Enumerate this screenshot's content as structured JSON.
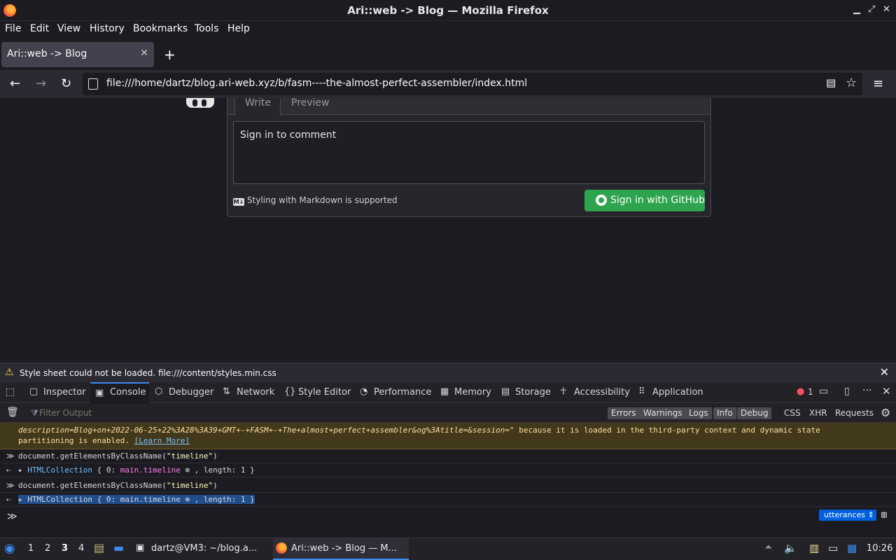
{
  "window": {
    "title": "Ari::web -> Blog — Mozilla Firefox"
  },
  "menu": [
    "File",
    "Edit",
    "View",
    "History",
    "Bookmarks",
    "Tools",
    "Help"
  ],
  "tabs": [
    {
      "label": "Ari::web -> Blog"
    }
  ],
  "address": {
    "url": "file:///home/dartz/blog.ari-web.xyz/b/fasm----the-almost-perfect-assembler/index.html"
  },
  "comment": {
    "tab_write": "Write",
    "tab_preview": "Preview",
    "textarea_placeholder": "Sign in to comment",
    "markdown_note": "Styling with Markdown is supported",
    "signin_button": "Sign in with GitHub"
  },
  "warning_bar": {
    "text": "Style sheet could not be loaded. file:///content/styles.min.css"
  },
  "devtools": {
    "tabs": [
      {
        "label": "Inspector",
        "icon": "inspector-icon"
      },
      {
        "label": "Console",
        "icon": "console-icon"
      },
      {
        "label": "Debugger",
        "icon": "debugger-icon"
      },
      {
        "label": "Network",
        "icon": "network-icon"
      },
      {
        "label": "Style Editor",
        "icon": "style-editor-icon"
      },
      {
        "label": "Performance",
        "icon": "performance-icon"
      },
      {
        "label": "Memory",
        "icon": "memory-icon"
      },
      {
        "label": "Storage",
        "icon": "storage-icon"
      },
      {
        "label": "Accessibility",
        "icon": "accessibility-icon"
      },
      {
        "label": "Application",
        "icon": "application-icon"
      }
    ],
    "error_count": "1",
    "filter_placeholder": "Filter Output",
    "filter_buttons": [
      "Errors",
      "Warnings",
      "Logs",
      "Info",
      "Debug"
    ],
    "filter_links": [
      "CSS",
      "XHR",
      "Requests"
    ],
    "context": "utterances"
  },
  "console": {
    "warning_line1": "description=Blog+on+2022-06-25+22%3A28%3A39+GMT+-+FASM+-+The+almost+perfect+assembler&og%3Atitle=&session=\"",
    "warning_line1_tail": " because it is loaded in the third-party context and dynamic state",
    "warning_line2": "partitioning is enabled. ",
    "learn_more": "[Learn More]",
    "entries": [
      {
        "input_fn": "document.getElementsByClassName(",
        "input_arg": "\"timeline\"",
        "input_close": ")",
        "out_type": "HTMLCollection",
        "out_open": " { 0: ",
        "out_val": "main.timeline",
        "out_close": " , length: 1 }"
      },
      {
        "input_fn": "document.getElementsByClassName(",
        "input_arg": "\"timeline\"",
        "input_close": ")",
        "out_type": "HTMLCollection",
        "out_open": " { 0: ",
        "out_val": "main.timeline",
        "out_close": " , length: 1 }"
      }
    ]
  },
  "taskbar": {
    "workspaces": [
      "1",
      "2",
      "3",
      "4"
    ],
    "active_workspace": "3",
    "tasks": [
      "dartz@VM3: ~/blog.a...",
      "Ari::web -> Blog — M..."
    ],
    "clock": "10:26"
  }
}
